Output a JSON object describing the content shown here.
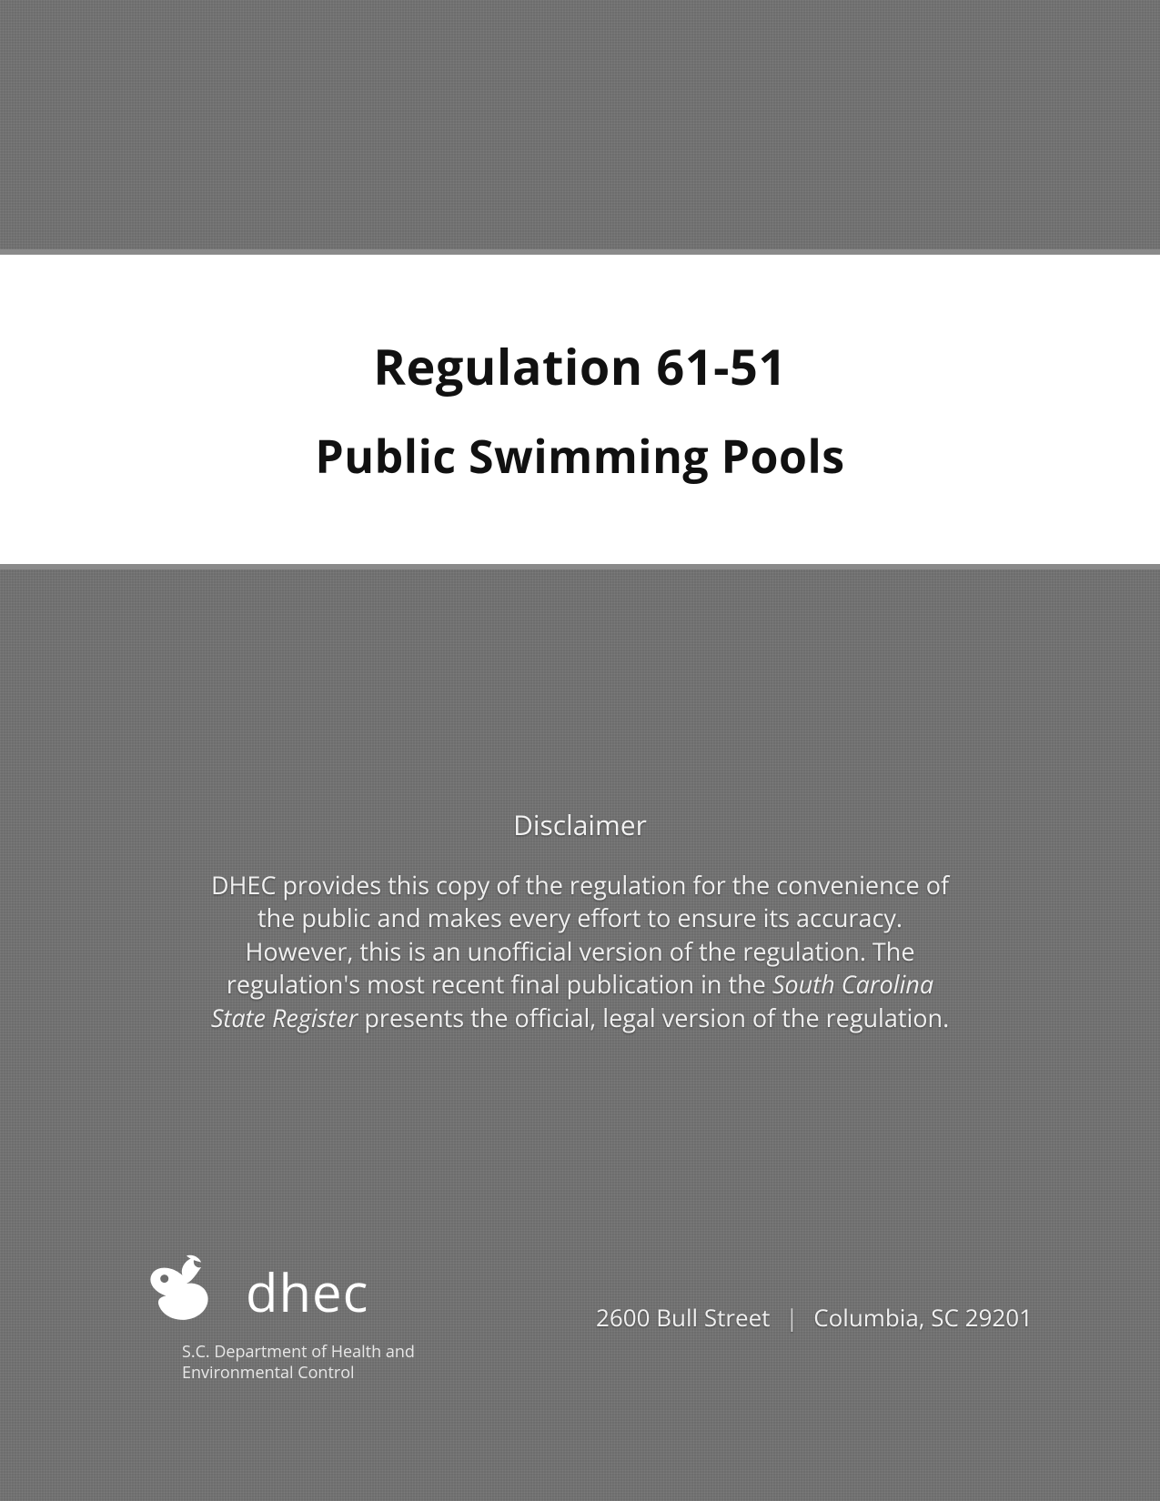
{
  "title": {
    "line1": "Regulation 61-51",
    "line2": "Public Swimming Pools"
  },
  "disclaimer": {
    "heading": "Disclaimer",
    "body_pre": "DHEC provides this copy of the regulation for the convenience of the public and makes every effort to ensure its accuracy.  However, this is an unofficial version of the regulation.  The regulation's most recent final publication in the ",
    "body_em": "South Carolina State Register",
    "body_post": " presents the official, legal version of the regulation."
  },
  "footer": {
    "logo_word": "dhec",
    "org_line1": "S.C. Department of Health and",
    "org_line2": "Environmental Control",
    "address_street": "2600 Bull Street",
    "address_sep": "|",
    "address_city": "Columbia, SC 29201"
  }
}
